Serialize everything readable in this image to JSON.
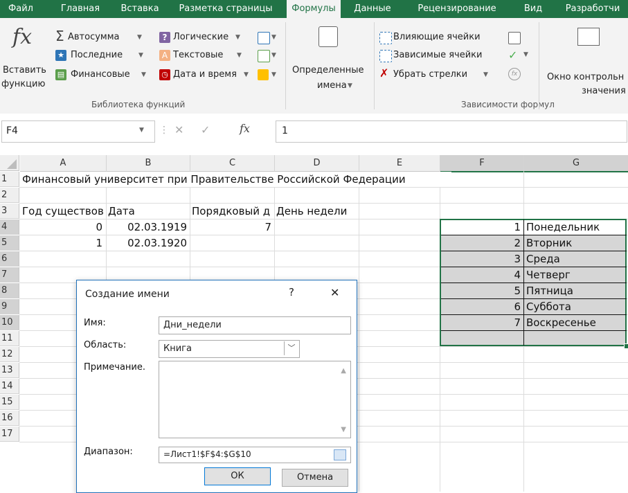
{
  "ribbon_tabs": [
    "Файл",
    "Главная",
    "Вставка",
    "Разметка страницы",
    "Формулы",
    "Данные",
    "Рецензирование",
    "Вид",
    "Разработчи"
  ],
  "active_tab": "Формулы",
  "ribbon": {
    "insert_function": {
      "line1": "Вставить",
      "line2": "функцию",
      "glyph": "fx"
    },
    "lib_items": [
      {
        "label": "Автосумма",
        "glyph": "Σ"
      },
      {
        "label": "Последние",
        "glyph": "★"
      },
      {
        "label": "Финансовые",
        "glyph": "▤"
      },
      {
        "label": "Логические",
        "glyph": "?"
      },
      {
        "label": "Текстовые",
        "glyph": "A"
      },
      {
        "label": "Дата и время",
        "glyph": "◷"
      }
    ],
    "lib_group_label": "Библиотека функций",
    "defined_names": {
      "line1": "Определенные",
      "line2": "имена"
    },
    "audit_items": [
      {
        "label": "Влияющие ячейки"
      },
      {
        "label": "Зависимые ячейки"
      },
      {
        "label": "Убрать стрелки"
      }
    ],
    "audit_group_label": "Зависимости формул",
    "watch_window": {
      "line1": "Окно контрольн",
      "line2": "значения"
    }
  },
  "formula_bar": {
    "name_box": "F4",
    "fx_symbol": "fx",
    "value": "1"
  },
  "columns": [
    "A",
    "B",
    "C",
    "D",
    "E",
    "F",
    "G"
  ],
  "rows": [
    "1",
    "2",
    "3",
    "4",
    "5",
    "6",
    "7",
    "8",
    "9",
    "10",
    "11",
    "12",
    "13",
    "14",
    "15",
    "16",
    "17"
  ],
  "cells": {
    "a1": "Финансовый университет при Правительстве Российской Федерации",
    "a3": "Год существов",
    "b3": "Дата",
    "c3": "Порядковый д",
    "d3": "День недели",
    "a4": "0",
    "b4": "02.03.1919",
    "c4": "7",
    "a5": "1",
    "b5": "02.03.1920"
  },
  "weekdays": [
    {
      "n": "1",
      "name": "Понедельник"
    },
    {
      "n": "2",
      "name": "Вторник"
    },
    {
      "n": "3",
      "name": "Среда"
    },
    {
      "n": "4",
      "name": "Четверг"
    },
    {
      "n": "5",
      "name": "Пятница"
    },
    {
      "n": "6",
      "name": "Суббота"
    },
    {
      "n": "7",
      "name": "Воскресенье"
    }
  ],
  "dialog": {
    "title": "Создание имени",
    "help": "?",
    "close": "✕",
    "name_label": "Имя:",
    "name_value": "Дни_недели",
    "scope_label": "Область:",
    "scope_value": "Книга",
    "comment_label": "Примечание.",
    "range_label": "Диапазон:",
    "range_value": "=Лист1!$F$4:$G$10",
    "ok": "ОК",
    "cancel": "Отмена"
  },
  "colors": {
    "excel_green": "#217346",
    "selection_gray": "#d6d6d6",
    "dialog_border": "#1e6fb8"
  }
}
